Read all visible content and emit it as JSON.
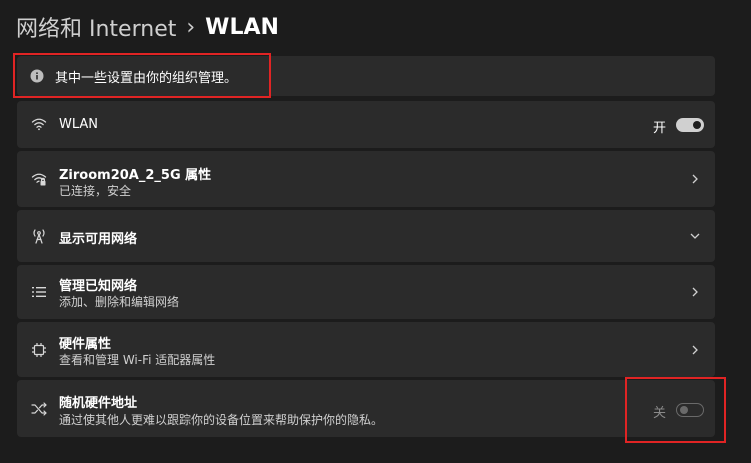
{
  "breadcrumb": {
    "parent": "网络和 Internet",
    "separator": "›",
    "current": "WLAN"
  },
  "notice": {
    "icon": "info-icon",
    "text": "其中一些设置由你的组织管理。"
  },
  "wlan": {
    "icon": "wifi-icon",
    "title": "WLAN",
    "toggle_label": "开",
    "toggle_state": "on"
  },
  "network_props": {
    "icon": "wifi-lock-icon",
    "title": "Ziroom20A_2_5G 属性",
    "subtitle": "已连接，安全"
  },
  "show_networks": {
    "icon": "antenna-icon",
    "title": "显示可用网络"
  },
  "manage_known": {
    "icon": "list-icon",
    "title": "管理已知网络",
    "subtitle": "添加、删除和编辑网络"
  },
  "hardware_props": {
    "icon": "chip-icon",
    "title": "硬件属性",
    "subtitle": "查看和管理 Wi-Fi 适配器属性"
  },
  "random_mac": {
    "icon": "shuffle-icon",
    "title": "随机硬件地址",
    "subtitle": "通过使其他人更难以跟踪你的设备位置来帮助保护你的隐私。",
    "toggle_label": "关",
    "toggle_state": "off"
  },
  "colors": {
    "background": "#1c1c1c",
    "card": "#2b2b2b",
    "highlight": "#e02424"
  }
}
